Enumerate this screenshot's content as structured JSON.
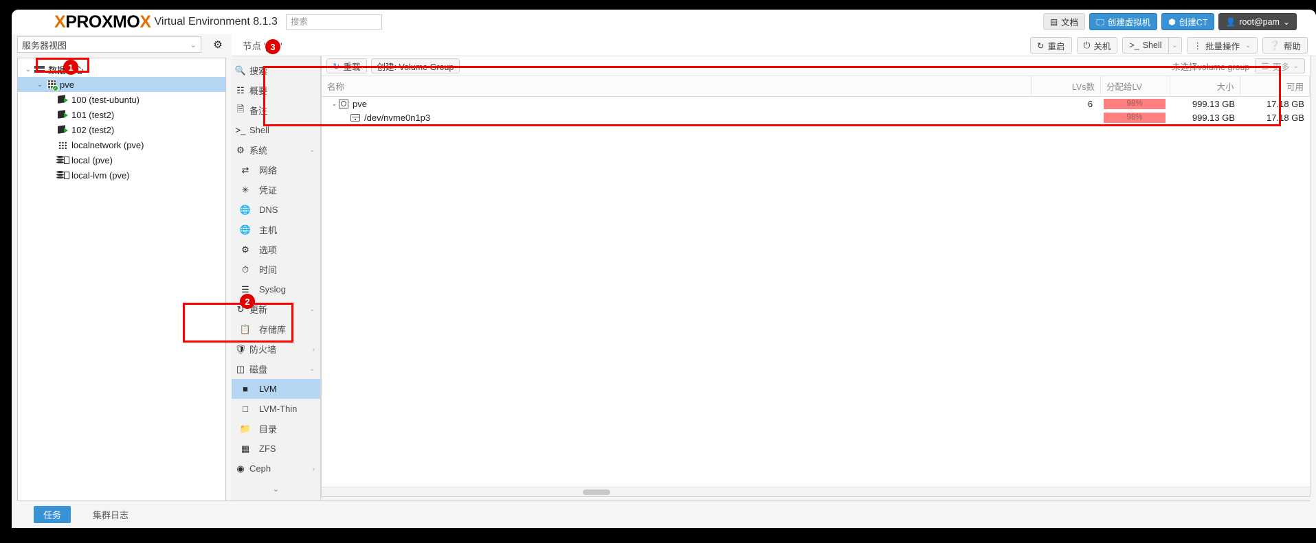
{
  "masthead": {
    "logo_pre": "X",
    "logo_text": "PROXMO",
    "logo_post": "X",
    "product": "Virtual Environment 8.1.3",
    "search_placeholder": "搜索",
    "buttons": [
      {
        "label": "文档",
        "icon": "book-icon",
        "style": "grey"
      },
      {
        "label": "创建虚拟机",
        "icon": "monitor-icon",
        "style": "blue"
      },
      {
        "label": "创建CT",
        "icon": "container-icon",
        "style": "blue"
      },
      {
        "label": "root@pam",
        "icon": "user-icon",
        "style": "dark",
        "caret": "⌄"
      }
    ]
  },
  "serverview": {
    "label": "服务器视图",
    "caret": "⌄",
    "gear_icon": "gear-icon"
  },
  "tree": {
    "items": [
      {
        "label": "数据中心",
        "icon": "datacenter-icon",
        "twisty": "⌄",
        "indent": 0,
        "selected": false
      },
      {
        "label": "pve",
        "icon": "node-icon",
        "twisty": "⌄",
        "indent": 1,
        "selected": true
      },
      {
        "label": "100 (test-ubuntu)",
        "icon": "vm-icon",
        "twisty": "",
        "indent": 2,
        "selected": false
      },
      {
        "label": "101 (test2)",
        "icon": "vm-icon",
        "twisty": "",
        "indent": 2,
        "selected": false
      },
      {
        "label": "102 (test2)",
        "icon": "vm-icon",
        "twisty": "",
        "indent": 2,
        "selected": false
      },
      {
        "label": "localnetwork (pve)",
        "icon": "network-icon",
        "twisty": "",
        "indent": 2,
        "selected": false
      },
      {
        "label": "local (pve)",
        "icon": "storage-icon",
        "twisty": "",
        "indent": 2,
        "selected": false
      },
      {
        "label": "local-lvm (pve)",
        "icon": "storage-icon",
        "twisty": "",
        "indent": 2,
        "selected": false
      }
    ]
  },
  "node": {
    "title": "节点 'pve'",
    "buttons": [
      {
        "label": "重启",
        "icon": "restart-icon",
        "split": false
      },
      {
        "label": "关机",
        "icon": "power-icon",
        "split": false
      },
      {
        "label": "Shell",
        "icon": "terminal-icon",
        "split": true,
        "caret": "⌄"
      },
      {
        "label": "批量操作",
        "icon": "kebab-icon",
        "split": false,
        "caret": "⌄"
      },
      {
        "label": "帮助",
        "icon": "help-icon",
        "split": false
      }
    ]
  },
  "navmenu": {
    "items": [
      {
        "label": "搜索",
        "icon": "search-icon",
        "level": 0,
        "selected": false,
        "trailing": ""
      },
      {
        "label": "概要",
        "icon": "summary-icon",
        "level": 0,
        "selected": false,
        "trailing": ""
      },
      {
        "label": "备注",
        "icon": "notes-icon",
        "level": 0,
        "selected": false,
        "trailing": ""
      },
      {
        "label": "Shell",
        "icon": "terminal-icon",
        "level": 0,
        "selected": false,
        "trailing": ""
      },
      {
        "label": "系统",
        "icon": "system-icon",
        "level": 0,
        "selected": false,
        "trailing": "⌄"
      },
      {
        "label": "网络",
        "icon": "network-icon",
        "level": 1,
        "selected": false,
        "trailing": ""
      },
      {
        "label": "凭证",
        "icon": "certificate-icon",
        "level": 1,
        "selected": false,
        "trailing": ""
      },
      {
        "label": "DNS",
        "icon": "globe-icon",
        "level": 1,
        "selected": false,
        "trailing": ""
      },
      {
        "label": "主机",
        "icon": "globe-icon",
        "level": 1,
        "selected": false,
        "trailing": ""
      },
      {
        "label": "选项",
        "icon": "gear-icon",
        "level": 1,
        "selected": false,
        "trailing": ""
      },
      {
        "label": "时间",
        "icon": "clock-icon",
        "level": 1,
        "selected": false,
        "trailing": ""
      },
      {
        "label": "Syslog",
        "icon": "list-icon",
        "level": 1,
        "selected": false,
        "trailing": ""
      },
      {
        "label": "更新",
        "icon": "refresh-icon",
        "level": 0,
        "selected": false,
        "trailing": "⌄"
      },
      {
        "label": "存储库",
        "icon": "repository-icon",
        "level": 1,
        "selected": false,
        "trailing": ""
      },
      {
        "label": "防火墙",
        "icon": "shield-icon",
        "level": 0,
        "selected": false,
        "trailing": "›"
      },
      {
        "label": "磁盘",
        "icon": "disk-icon",
        "level": 0,
        "selected": false,
        "trailing": "⌄"
      },
      {
        "label": "LVM",
        "icon": "lvm-icon",
        "level": 1,
        "selected": true,
        "trailing": ""
      },
      {
        "label": "LVM-Thin",
        "icon": "lvmthin-icon",
        "level": 1,
        "selected": false,
        "trailing": ""
      },
      {
        "label": "目录",
        "icon": "folder-icon",
        "level": 1,
        "selected": false,
        "trailing": ""
      },
      {
        "label": "ZFS",
        "icon": "zfs-icon",
        "level": 1,
        "selected": false,
        "trailing": ""
      },
      {
        "label": "Ceph",
        "icon": "ceph-icon",
        "level": 0,
        "selected": false,
        "trailing": "›"
      }
    ],
    "more_caret": "⌄"
  },
  "content": {
    "toolbar": {
      "reload_label": "重载",
      "reload_icon": "refresh-icon",
      "create_vg_label": "创建: Volume Group",
      "no_selection_label": "未选择volume group",
      "more_label": "更多",
      "more_icon": "hamburger-icon",
      "more_caret": "⌄"
    },
    "table": {
      "columns": [
        {
          "key": "name",
          "label": "名称",
          "align": "left"
        },
        {
          "key": "lvs",
          "label": "LVs数",
          "align": "right"
        },
        {
          "key": "alloc",
          "label": "分配给LV",
          "align": "left"
        },
        {
          "key": "size",
          "label": "大小",
          "align": "right"
        },
        {
          "key": "free",
          "label": "可用",
          "align": "right"
        }
      ],
      "rows": [
        {
          "name": "pve",
          "icon": "volume-group-icon",
          "twisty": "⌄",
          "indent": 0,
          "lvs": "6",
          "alloc_pct": 98,
          "alloc_label": "98%",
          "size": "999.13 GB",
          "free": "17.18 GB"
        },
        {
          "name": "/dev/nvme0n1p3",
          "icon": "physical-volume-icon",
          "twisty": "",
          "indent": 1,
          "lvs": "",
          "alloc_pct": 98,
          "alloc_label": "98%",
          "size": "999.13 GB",
          "free": "17.18 GB"
        }
      ]
    }
  },
  "bottombar": {
    "tabs": [
      {
        "label": "任务",
        "selected": true
      },
      {
        "label": "集群日志",
        "selected": false
      }
    ]
  },
  "annotations": {
    "markers": [
      {
        "number": "1"
      },
      {
        "number": "2"
      },
      {
        "number": "3"
      }
    ]
  },
  "colors": {
    "accent_blue": "#3892d4",
    "brand_orange": "#e57000",
    "selection_blue": "#b6d7f3",
    "usage_red": "#fd7f7f",
    "annotation_red": "#e00000"
  }
}
